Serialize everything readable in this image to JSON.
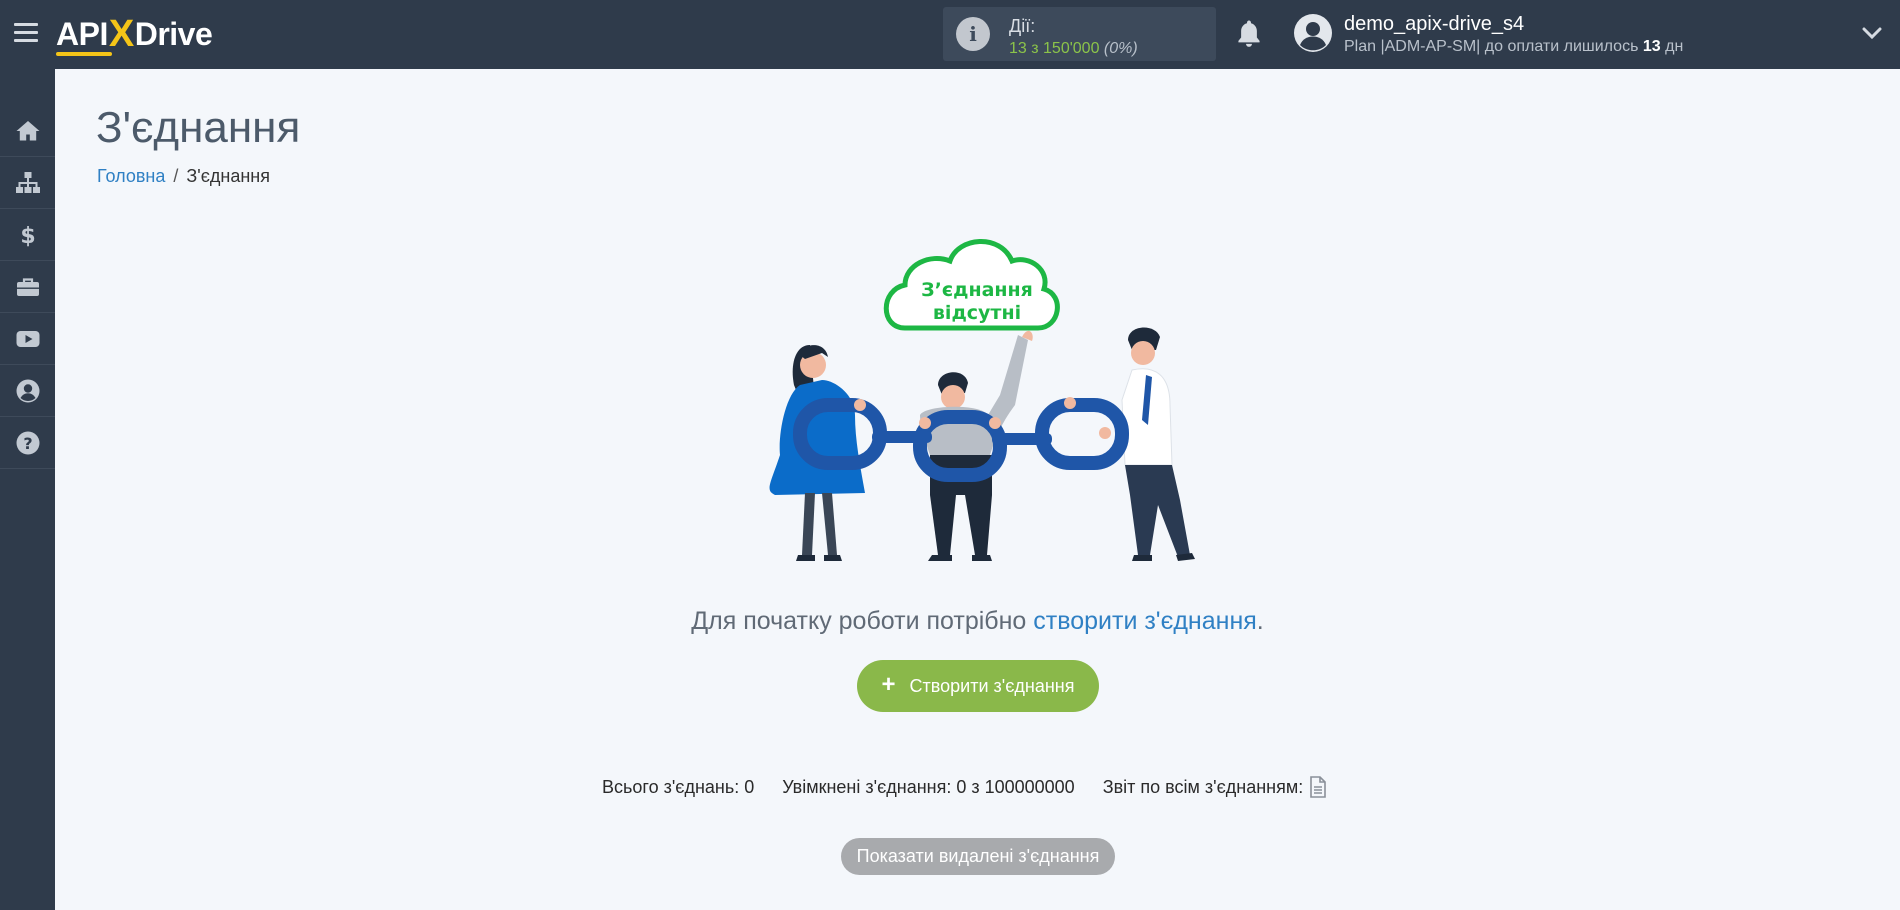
{
  "logo": {
    "part1": "API",
    "x": "X",
    "part2": "Drive"
  },
  "actions": {
    "title": "Дії:",
    "count": "13 з 150'000",
    "percent": "(0%)"
  },
  "user": {
    "name": "demo_apix-drive_s4",
    "plan_prefix": "Plan |ADM-AP-SM| до оплати лишилось ",
    "days": "13",
    "days_suffix": " дн"
  },
  "sidebar": {
    "items": [
      {
        "icon": "home-icon"
      },
      {
        "icon": "sitemap-icon"
      },
      {
        "icon": "dollar-icon"
      },
      {
        "icon": "briefcase-icon"
      },
      {
        "icon": "youtube-icon"
      },
      {
        "icon": "user-icon"
      },
      {
        "icon": "question-icon"
      }
    ]
  },
  "page": {
    "title": "З'єднання",
    "breadcrumb_home": "Головна",
    "breadcrumb_separator": "/",
    "breadcrumb_current": "З'єднання"
  },
  "illustration": {
    "cloud_line1": "З’єднання",
    "cloud_line2": "відсутні"
  },
  "empty_state": {
    "text_prefix": "Для початку роботи потрібно ",
    "link": "створити з'єднання",
    "text_suffix": "."
  },
  "create_button": {
    "label": "Створити з'єднання"
  },
  "stats": {
    "total": "Всього з'єднань: 0",
    "enabled": "Увімкнені з'єднання: 0 з 100000000",
    "report": "Звіт по всім з'єднанням:"
  },
  "deleted_button": {
    "label": "Показати видалені з'єднання"
  },
  "colors": {
    "topbar": "#2f3b4b",
    "accent_green": "#8ab84a",
    "link_blue": "#2f80c4",
    "cloud_green": "#1db744",
    "chain_blue": "#1f56a8"
  }
}
